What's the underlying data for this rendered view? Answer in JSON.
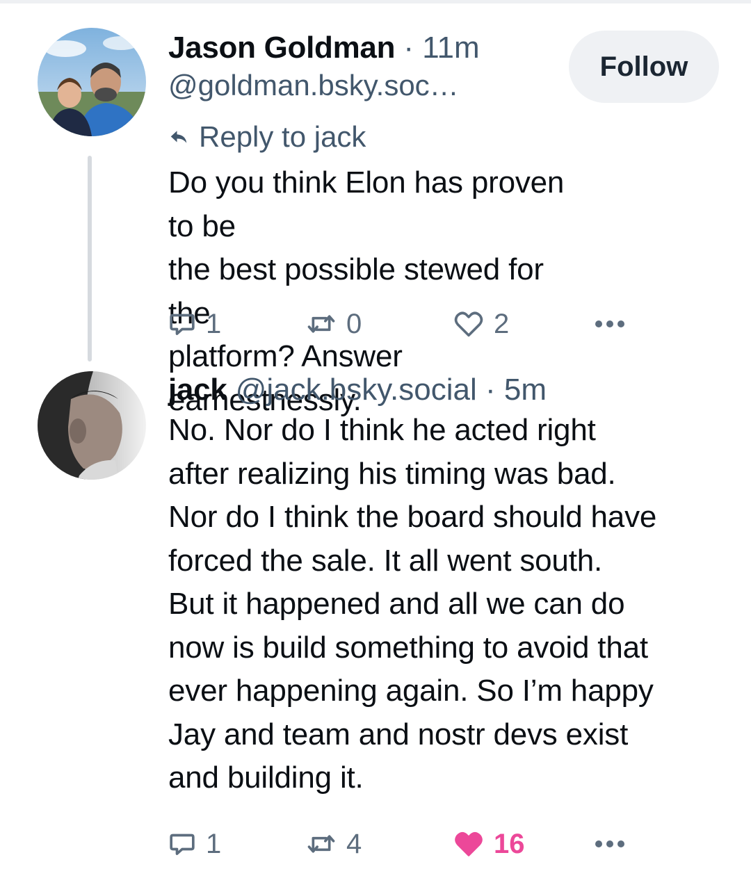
{
  "posts": [
    {
      "display_name": "Jason Goldman",
      "handle": "@goldman.bsky.soc…",
      "separator": "·",
      "time": "11m",
      "follow_label": "Follow",
      "reply_to": "Reply to jack",
      "body_lines": [
        "Do you think Elon has proven to be",
        "the best possible stewed for the",
        "platform? Answer earnestnessly."
      ],
      "counts": {
        "replies": "1",
        "reposts": "0",
        "likes": "2"
      },
      "liked": false
    },
    {
      "display_name": "jack",
      "handle": "@jack.bsky.social",
      "separator": "·",
      "time": "5m",
      "body_lines": [
        "No. Nor do I think he acted right",
        "after realizing his timing was bad.",
        "Nor do I think the board should have",
        "forced the sale. It all went south.",
        "But it happened and all we can do",
        "now is build something to avoid that",
        "ever happening again. So I’m happy",
        "Jay and team and nostr devs exist",
        "and building it."
      ],
      "counts": {
        "replies": "1",
        "reposts": "4",
        "likes": "16"
      },
      "liked": true
    }
  ],
  "icons": {
    "reply": "speech-bubble-icon",
    "repost": "repost-arrows-icon",
    "like": "heart-icon",
    "more": "ellipsis-icon",
    "reply_to": "reply-arrow-icon"
  },
  "colors": {
    "text": "#0b0f14",
    "muted": "#42576c",
    "icon": "#5d6d7e",
    "like_active": "#ec4899",
    "thread_line": "#d6dadf",
    "follow_bg": "#eff1f4"
  }
}
